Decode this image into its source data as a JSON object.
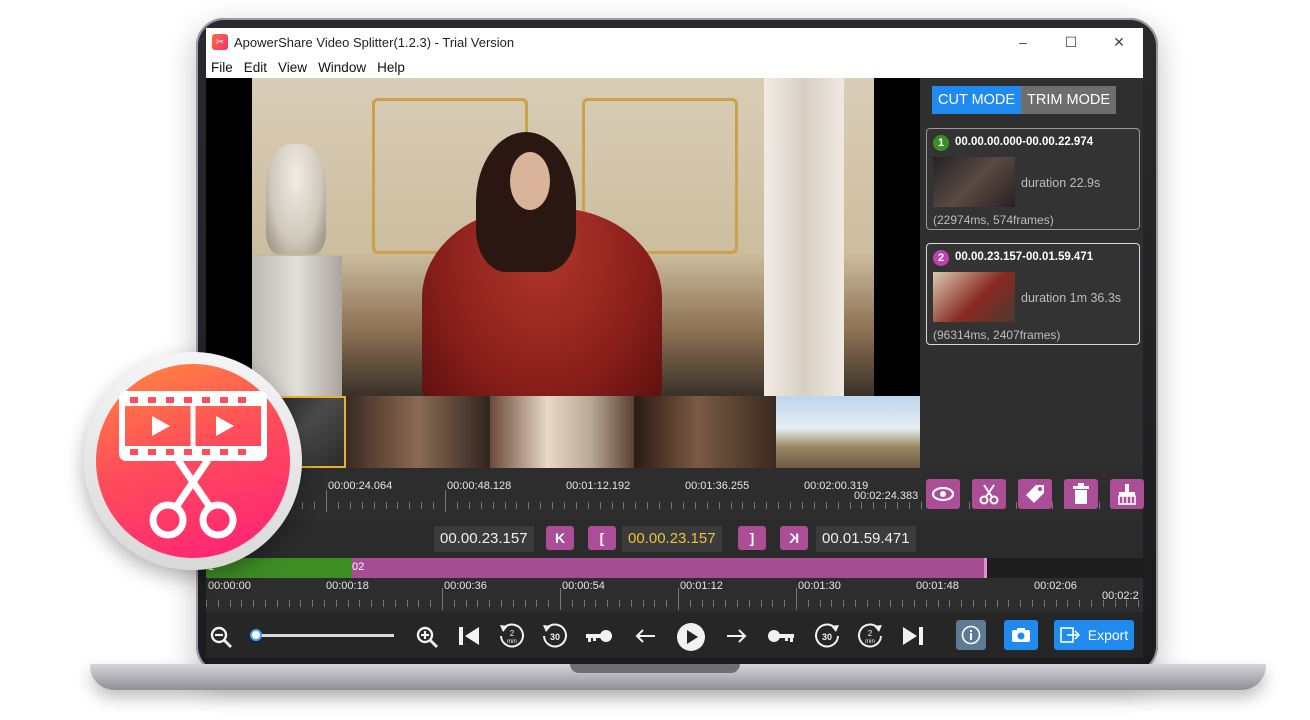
{
  "window": {
    "title": "ApowerShare Video Splitter(1.2.3) - Trial Version",
    "controls": [
      "–",
      "☐",
      "✕"
    ]
  },
  "menu": [
    "File",
    "Edit",
    "View",
    "Window",
    "Help"
  ],
  "modes": {
    "cut": "CUT MODE",
    "trim": "TRIM MODE",
    "active": "cut"
  },
  "segments": [
    {
      "index": "1",
      "range": "00.00.00.000-00.00.22.974",
      "duration": "duration 22.9s",
      "meta": "(22974ms, 574frames)",
      "color": "#3c8d24"
    },
    {
      "index": "2",
      "range": "00.00.23.157-00.01.59.471",
      "duration": "duration 1m 36.3s",
      "meta": "(96314ms, 2407frames)",
      "color": "#c13fb0"
    }
  ],
  "top_ruler": {
    "labels": [
      "00:00:24.064",
      "00:00:48.128",
      "00:01:12.192",
      "00:01:36.255",
      "00:02:00.319"
    ],
    "end_label": "00:02:24.383"
  },
  "time_controls": {
    "start": "00.00.23.157",
    "jump_start": "K",
    "mark_in": "[",
    "current": "00.00.23.157",
    "mark_out": "]",
    "jump_end": "K",
    "end": "00.01.59.471"
  },
  "segment_bar": {
    "label1": "1",
    "label2": "02"
  },
  "bottom_ruler": {
    "labels": [
      "00:00:00",
      "00:00:18",
      "00:00:36",
      "00:00:54",
      "00:01:12",
      "00:01:30",
      "00:01:48",
      "00:02:06"
    ],
    "end_label": "00:02:2"
  },
  "toolbar": {
    "zoom": 0.0,
    "export_label": "Export",
    "rewind_2_label": "2\nmin",
    "rewind_30_label": "30",
    "forward_30_label": "30",
    "forward_2_label": "2\nmin"
  },
  "colors": {
    "accent": "#1f8bf0",
    "action": "#ac4d97",
    "current_time": "#e8c43a"
  }
}
